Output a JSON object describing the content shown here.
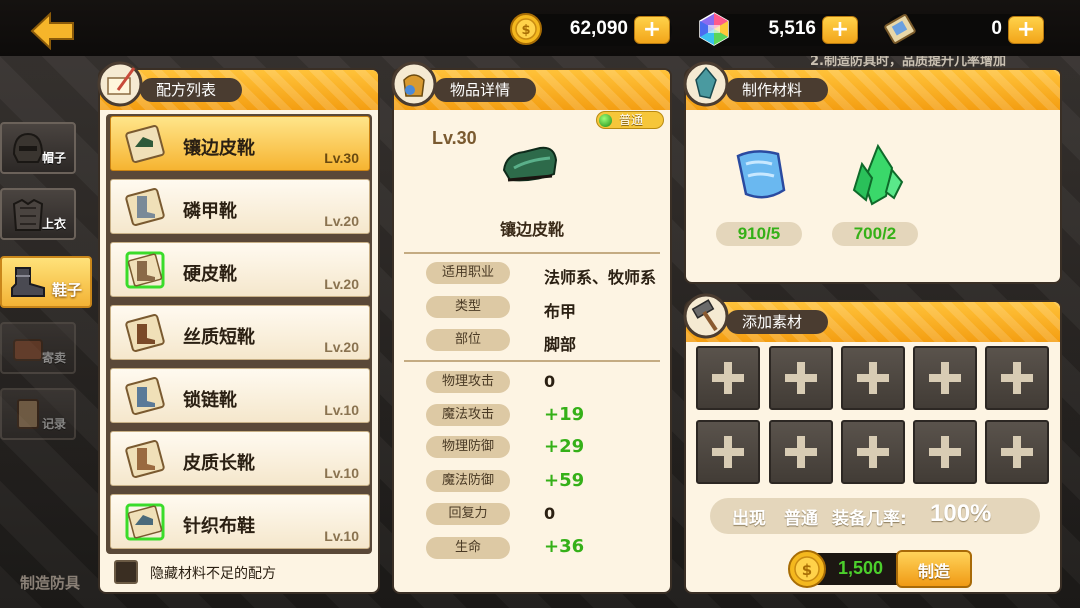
{
  "background_hints": {
    "bottom_left": "制造防具",
    "top_right": "2.制造防具时，品质提升几率增加"
  },
  "topbar": {
    "back_icon": "back-arrow-icon",
    "gold": {
      "value": "62,090",
      "icon": "gold-coin-icon",
      "plus": "+"
    },
    "gems": {
      "value": "5,516",
      "icon": "rainbow-gem-icon",
      "plus": "+"
    },
    "tickets": {
      "value": "0",
      "icon": "ticket-icon",
      "plus": "+"
    }
  },
  "side_tabs": [
    {
      "label": "帽子",
      "icon": "helmet-icon",
      "active": false,
      "dim": false
    },
    {
      "label": "上衣",
      "icon": "armor-icon",
      "active": false,
      "dim": false
    },
    {
      "label": "鞋子",
      "icon": "boots-icon",
      "active": true,
      "dim": false
    },
    {
      "label": "寄卖",
      "icon": "consign-icon",
      "active": false,
      "dim": true
    },
    {
      "label": "记录",
      "icon": "record-icon",
      "active": false,
      "dim": true
    }
  ],
  "recipe_panel": {
    "title": "配方列表",
    "recipes": [
      {
        "name": "镶边皮靴",
        "level": "Lv.30",
        "selected": true,
        "highlight": false
      },
      {
        "name": "磷甲靴",
        "level": "Lv.20",
        "selected": false,
        "highlight": false
      },
      {
        "name": "硬皮靴",
        "level": "Lv.20",
        "selected": false,
        "highlight": true
      },
      {
        "name": "丝质短靴",
        "level": "Lv.20",
        "selected": false,
        "highlight": false
      },
      {
        "name": "锁链靴",
        "level": "Lv.10",
        "selected": false,
        "highlight": false
      },
      {
        "name": "皮质长靴",
        "level": "Lv.10",
        "selected": false,
        "highlight": false
      },
      {
        "name": "针织布鞋",
        "level": "Lv.10",
        "selected": false,
        "highlight": true
      }
    ],
    "hide_label": "隐藏材料不足的配方"
  },
  "item_panel": {
    "title": "物品详情",
    "rarity": "普通",
    "level": "Lv.30",
    "name": "镶边皮靴",
    "info": [
      {
        "label": "适用职业",
        "value": "法师系、牧师系"
      },
      {
        "label": "类型",
        "value": "布甲"
      },
      {
        "label": "部位",
        "value": "脚部"
      }
    ],
    "stats": [
      {
        "label": "物理攻击",
        "value": "0",
        "bonus": false
      },
      {
        "label": "魔法攻击",
        "value": "+19",
        "bonus": true
      },
      {
        "label": "物理防御",
        "value": "+29",
        "bonus": true
      },
      {
        "label": "魔法防御",
        "value": "+59",
        "bonus": true
      },
      {
        "label": "回复力",
        "value": "0",
        "bonus": false
      },
      {
        "label": "生命",
        "value": "+36",
        "bonus": true
      }
    ]
  },
  "materials_panel": {
    "title": "制作材料",
    "materials": [
      {
        "icon": "blue-cloth-icon",
        "count": "910/5"
      },
      {
        "icon": "green-crystal-icon",
        "count": "700/2"
      }
    ]
  },
  "add_panel": {
    "title": "添加素材",
    "slot_count": 10,
    "chance": {
      "prefix": "出现",
      "quality": "普通",
      "mid": "装备几率:",
      "pct": "100%"
    },
    "craft": {
      "cost": "1,500",
      "label": "制造"
    }
  }
}
